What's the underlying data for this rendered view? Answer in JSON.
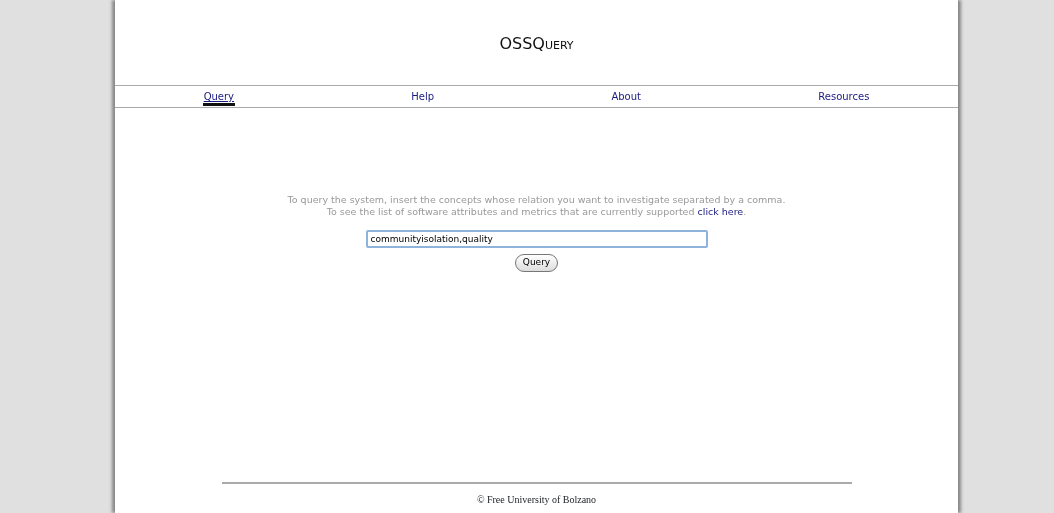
{
  "header": {
    "title": "OSSQuery"
  },
  "nav": [
    {
      "label": "Query",
      "selected": true
    },
    {
      "label": "Help",
      "selected": false
    },
    {
      "label": "About",
      "selected": false
    },
    {
      "label": "Resources",
      "selected": false
    }
  ],
  "instructions": {
    "line_1": "To query the system, insert the concepts whose relation you want to investigate separated by a comma.",
    "line_2": "To see the list of software attributes and metrics that are currently supported",
    "link": "click here",
    "end": "."
  },
  "query_field": {
    "value": "communityisolation,quality"
  },
  "query_button": "Query",
  "footer": "© Free University of Bolzano"
}
